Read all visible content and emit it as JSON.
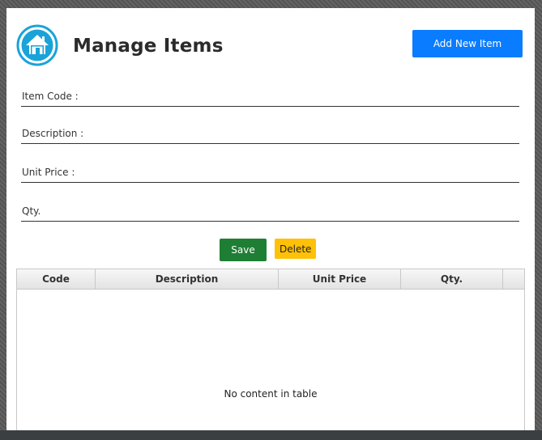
{
  "header": {
    "title": "Manage Items",
    "add_button_label": "Add New Item"
  },
  "form": {
    "item_code_label": "Item Code :",
    "description_label": "Description :",
    "unit_price_label": "Unit Price :",
    "qty_label": "Qty.",
    "item_code_value": "",
    "description_value": "",
    "unit_price_value": "",
    "qty_value": ""
  },
  "actions": {
    "save_label": "Save",
    "delete_label": "Delete"
  },
  "table": {
    "columns": [
      "Code",
      "Description",
      "Unit Price",
      "Qty."
    ],
    "rows": [],
    "empty_text": "No content in table"
  },
  "colors": {
    "primary": "#0a7cff",
    "success": "#1e7e34",
    "warning": "#ffc107",
    "logo": "#1aa3d9"
  },
  "icons": {
    "logo": "home-icon"
  }
}
